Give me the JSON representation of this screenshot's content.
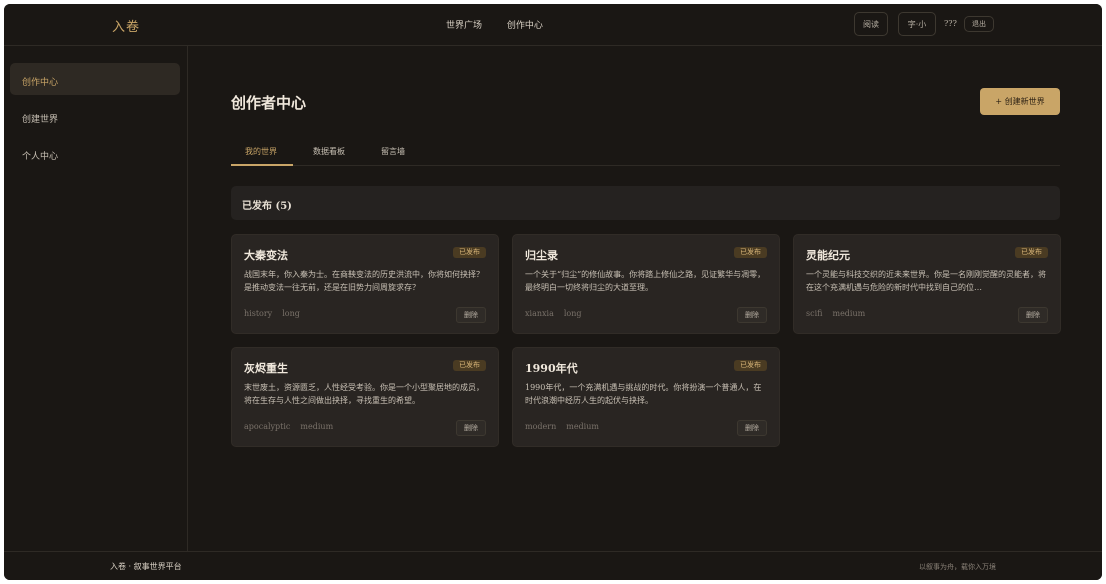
{
  "app": {
    "logo": "入卷"
  },
  "nav": {
    "links": [
      "世界广场",
      "创作中心"
    ]
  },
  "top": {
    "read_label": "阅读",
    "font_label": "字·小",
    "username": "???",
    "logout_label": "退出"
  },
  "sidebar": {
    "items": [
      {
        "label": "创作中心",
        "active": true
      },
      {
        "label": "创建世界",
        "active": false
      },
      {
        "label": "个人中心",
        "active": false
      }
    ]
  },
  "main": {
    "title": "创作者中心",
    "create_button": "+ 创建新世界",
    "tabs": [
      {
        "label": "我的世界",
        "active": true
      },
      {
        "label": "数据看板",
        "active": false
      },
      {
        "label": "留言墙",
        "active": false
      }
    ],
    "section_title": "已发布 (5)"
  },
  "cards": [
    {
      "title": "大秦变法",
      "status": "已发布",
      "desc": "战国末年，你入秦为士。在商鞅变法的历史洪流中，你将如何抉择？是推动变法一往无前，还是在旧势力间周旋求存？",
      "tags": [
        "history",
        "long"
      ],
      "delete": "删除"
    },
    {
      "title": "归尘录",
      "status": "已发布",
      "desc": "一个关于“归尘”的修仙故事。你将踏上修仙之路，见证繁华与凋零，最终明白一切终将归尘的大道至理。",
      "tags": [
        "xianxia",
        "long"
      ],
      "delete": "删除"
    },
    {
      "title": "灵能纪元",
      "status": "已发布",
      "desc": "一个灵能与科技交织的近未来世界。你是一名刚刚觉醒的灵能者，将在这个充满机遇与危险的新时代中找到自己的位…",
      "tags": [
        "scifi",
        "medium"
      ],
      "delete": "删除"
    },
    {
      "title": "灰烬重生",
      "status": "已发布",
      "desc": "末世废土，资源匮乏，人性经受考验。你是一个小型聚居地的成员，将在生存与人性之间做出抉择，寻找重生的希望。",
      "tags": [
        "apocalyptic",
        "medium"
      ],
      "delete": "删除"
    },
    {
      "title": "1990年代",
      "status": "已发布",
      "desc": "1990年代，一个充满机遇与挑战的时代。你将扮演一个普通人，在时代浪潮中经历人生的起伏与抉择。",
      "tags": [
        "modern",
        "medium"
      ],
      "delete": "删除"
    }
  ],
  "footer": {
    "left": "入卷 · 叙事世界平台",
    "right": "以叙事为舟，载你入万境"
  }
}
